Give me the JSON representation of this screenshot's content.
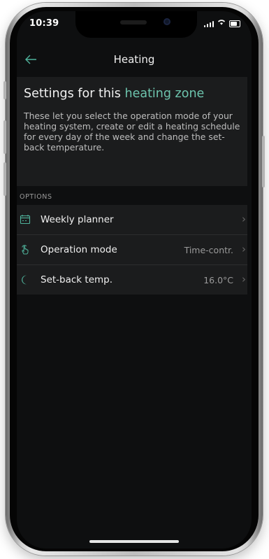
{
  "status_bar": {
    "time": "10:39"
  },
  "nav": {
    "title": "Heating"
  },
  "intro": {
    "heading_prefix": "Settings for this",
    "heading_accent": "heating zone",
    "description": "These let you select the operation mode of your heating system, create or edit a heating schedule for every day of the week and change the set-back temperature."
  },
  "options": {
    "section_label": "OPTIONS",
    "items": [
      {
        "label": "Weekly planner",
        "value": "",
        "icon": "calendar-icon"
      },
      {
        "label": "Operation mode",
        "value": "Time-contr.",
        "icon": "touch-hand-icon"
      },
      {
        "label": "Set-back temp.",
        "value": "16.0°C",
        "icon": "moon-icon"
      }
    ]
  },
  "colors": {
    "accent": "#4fb39c",
    "background": "#0e0f10",
    "card": "#1b1c1d"
  }
}
